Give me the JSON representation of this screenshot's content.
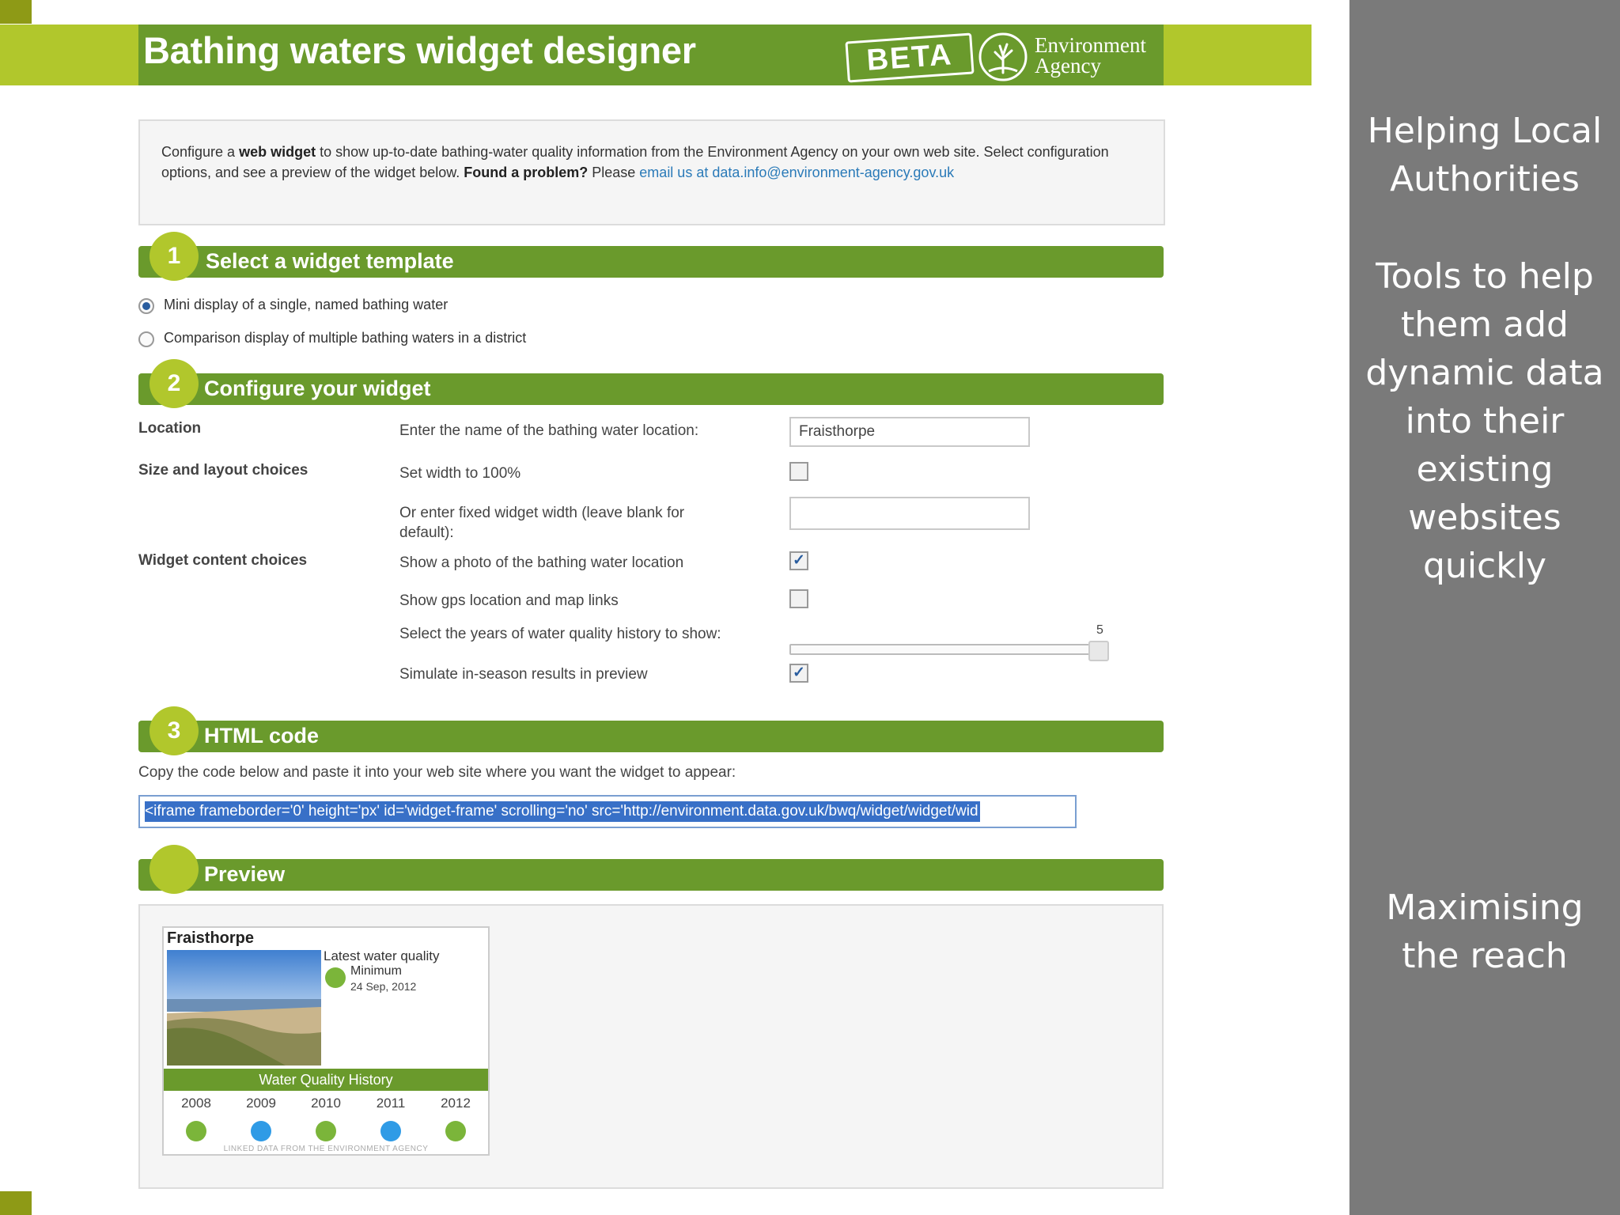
{
  "header": {
    "title": "Bathing waters widget designer",
    "beta_label": "BETA",
    "org_name_line1": "Environment",
    "org_name_line2": "Agency"
  },
  "intro": {
    "line1_pre": "Configure a ",
    "line1_bold": "web widget",
    "line1_post": " to show up-to-date bathing-water quality information from the Environment Agency on your own web site.",
    "line2_pre": "Select configuration options, and see a preview of the widget below. ",
    "line2_bold": "Found a problem?",
    "line2_post": " Please ",
    "link_text": "email us at data.info@environment-agency.gov.uk"
  },
  "sections": {
    "s1": {
      "num": "1",
      "label": "Select a widget template"
    },
    "s2": {
      "num": "2",
      "label": "Configure your widget"
    },
    "s3": {
      "num": "3",
      "label": "HTML code"
    },
    "preview": {
      "label": "Preview"
    }
  },
  "templates": [
    {
      "label": "Mini display of a single, named bathing water",
      "selected": true
    },
    {
      "label": "Comparison display of multiple bathing waters in a district",
      "selected": false
    }
  ],
  "config": {
    "location_heading": "Location",
    "location_prompt": "Enter the name of the bathing water location:",
    "location_value": "Fraisthorpe",
    "size_heading": "Size and layout choices",
    "width_100_label": "Set width to 100%",
    "width_100_checked": false,
    "fixed_width_label": "Or enter fixed widget width (leave blank for default):",
    "fixed_width_value": "",
    "content_heading": "Widget content choices",
    "photo_label": "Show a photo of the bathing water location",
    "photo_checked": true,
    "gps_label": "Show gps location and map links",
    "gps_checked": false,
    "years_label": "Select the years of water quality history to show:",
    "years_value": "5",
    "simulate_label": "Simulate in-season results in preview",
    "simulate_checked": true
  },
  "html_code": {
    "hint": "Copy the code below and paste it into your web site where you want the widget to appear:",
    "code": "<iframe frameborder='0' height='px' id='widget-frame' scrolling='no' src='http://environment.data.gov.uk/bwq/widget/widget/wid"
  },
  "widget": {
    "title": "Fraisthorpe",
    "latest_label": "Latest water quality",
    "latest_class": "Minimum",
    "latest_date": "24 Sep, 2012",
    "history_label": "Water Quality History",
    "years": [
      {
        "year": "2008",
        "color": "#7bb53a"
      },
      {
        "year": "2009",
        "color": "#2f9be6"
      },
      {
        "year": "2010",
        "color": "#7bb53a"
      },
      {
        "year": "2011",
        "color": "#2f9be6"
      },
      {
        "year": "2012",
        "color": "#7bb53a"
      }
    ],
    "footer": "LINKED DATA FROM THE ENVIRONMENT AGENCY"
  },
  "sidebar": {
    "block1_lines": [
      "Helping Local",
      "Authorities"
    ],
    "block2_lines": [
      "Tools to help",
      "them add",
      "dynamic data",
      "into their",
      "existing",
      "websites",
      "quickly"
    ],
    "block3_lines": [
      "Maximising",
      "the reach"
    ]
  },
  "colors": {
    "header_green": "#6a9a2c",
    "lime_accent": "#b1c72c",
    "sidebar_gray": "#7a7a7a",
    "dot_green": "#7bb53a",
    "dot_blue": "#2f9be6"
  }
}
